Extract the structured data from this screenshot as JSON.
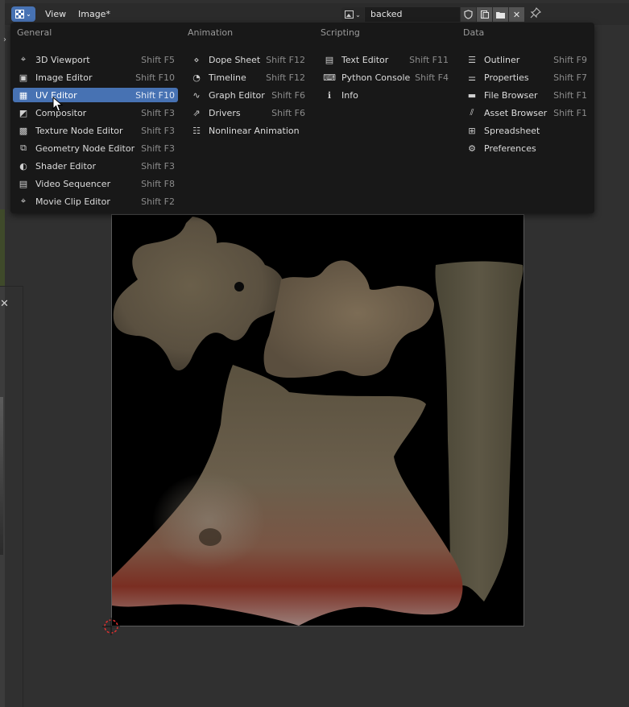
{
  "header": {
    "menu_view": "View",
    "menu_image": "Image*",
    "image_name": "backed"
  },
  "dropdown": {
    "columns": [
      {
        "title": "General",
        "items": [
          {
            "label": "3D Viewport",
            "shortcut": "Shift F5",
            "icon": "viewport-3d-icon"
          },
          {
            "label": "Image Editor",
            "shortcut": "Shift F10",
            "icon": "image-editor-icon"
          },
          {
            "label": "UV Editor",
            "shortcut": "Shift F10",
            "icon": "uv-editor-icon",
            "active": true
          },
          {
            "label": "Compositor",
            "shortcut": "Shift F3",
            "icon": "compositor-icon"
          },
          {
            "label": "Texture Node Editor",
            "shortcut": "Shift F3",
            "icon": "texture-node-icon"
          },
          {
            "label": "Geometry Node Editor",
            "shortcut": "Shift F3",
            "icon": "geometry-node-icon"
          },
          {
            "label": "Shader Editor",
            "shortcut": "Shift F3",
            "icon": "shader-editor-icon"
          },
          {
            "label": "Video Sequencer",
            "shortcut": "Shift F8",
            "icon": "video-sequencer-icon"
          },
          {
            "label": "Movie Clip Editor",
            "shortcut": "Shift F2",
            "icon": "movie-clip-icon"
          }
        ]
      },
      {
        "title": "Animation",
        "items": [
          {
            "label": "Dope Sheet",
            "shortcut": "Shift F12",
            "icon": "dope-sheet-icon"
          },
          {
            "label": "Timeline",
            "shortcut": "Shift F12",
            "icon": "timeline-icon"
          },
          {
            "label": "Graph Editor",
            "shortcut": "Shift F6",
            "icon": "graph-editor-icon"
          },
          {
            "label": "Drivers",
            "shortcut": "Shift F6",
            "icon": "drivers-icon"
          },
          {
            "label": "Nonlinear Animation",
            "shortcut": "",
            "icon": "nla-icon"
          }
        ]
      },
      {
        "title": "Scripting",
        "items": [
          {
            "label": "Text Editor",
            "shortcut": "Shift F11",
            "icon": "text-editor-icon"
          },
          {
            "label": "Python Console",
            "shortcut": "Shift F4",
            "icon": "python-console-icon"
          },
          {
            "label": "Info",
            "shortcut": "",
            "icon": "info-icon"
          }
        ]
      },
      {
        "title": "Data",
        "items": [
          {
            "label": "Outliner",
            "shortcut": "Shift F9",
            "icon": "outliner-icon"
          },
          {
            "label": "Properties",
            "shortcut": "Shift F7",
            "icon": "properties-icon"
          },
          {
            "label": "File Browser",
            "shortcut": "Shift F1",
            "icon": "file-browser-icon"
          },
          {
            "label": "Asset Browser",
            "shortcut": "Shift F1",
            "icon": "asset-browser-icon"
          },
          {
            "label": "Spreadsheet",
            "shortcut": "",
            "icon": "spreadsheet-icon"
          },
          {
            "label": "Preferences",
            "shortcut": "",
            "icon": "preferences-icon"
          }
        ]
      }
    ]
  },
  "colors": {
    "accent": "#4772b3",
    "menu_bg": "#181818",
    "header_bg": "#2b2b2b",
    "area_bg": "#303030"
  }
}
